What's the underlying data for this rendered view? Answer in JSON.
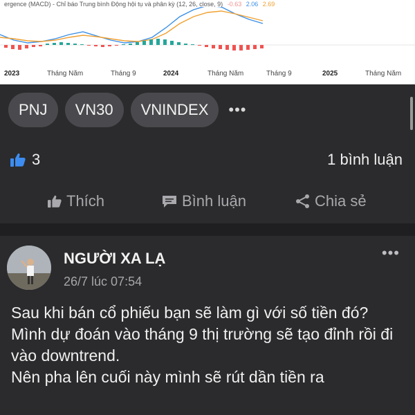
{
  "chart": {
    "title_text": "ergence (MACD) - Chỉ báo Trung bình Động hội tụ và phân kỳ (12, 26, close, 9)",
    "v1": "-0.63",
    "v2": "2.06",
    "v3": "2.69",
    "axis_labels": [
      "2023",
      "Tháng Năm",
      "Tháng 9",
      "2024",
      "Tháng Năm",
      "Tháng 9",
      "2025",
      "Tháng Năm"
    ]
  },
  "tags": [
    "PNJ",
    "VN30",
    "VNINDEX"
  ],
  "more_icon": "•••",
  "stats": {
    "likes": "3",
    "comments": "1 bình luận"
  },
  "actions": {
    "like": "Thích",
    "comment": "Bình luận",
    "share": "Chia sẻ"
  },
  "post": {
    "author": "NGƯỜI XA LẠ",
    "timestamp": "26/7 lúc 07:54",
    "menu_icon": "•••",
    "lines": [
      "Sau khi bán cổ phiếu bạn sẽ làm gì với số tiền đó?",
      "Mình dự đoán vào tháng 9 thị trường sẽ tạo đỉnh rồi đi vào downtrend.",
      "Nên pha lên cuối này mình sẽ rút dần tiền ra"
    ]
  },
  "colors": {
    "background": "#2b2b2d",
    "chip": "#4a4a4e",
    "like_blue": "#3d8cf0",
    "macd_blue": "#3a8ee6",
    "signal_orange": "#f0a030"
  }
}
